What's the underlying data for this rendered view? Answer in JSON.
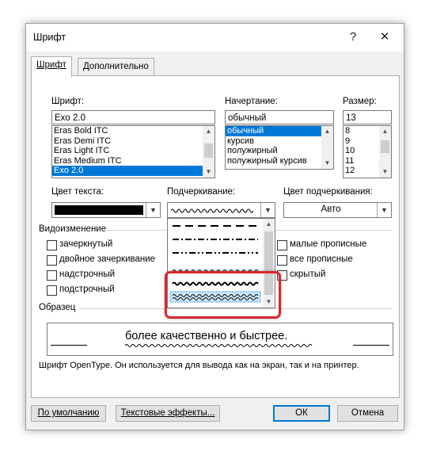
{
  "dialog": {
    "title": "Шрифт",
    "help": "?",
    "close": "✕"
  },
  "tabs": [
    {
      "label": "Шрифт"
    },
    {
      "label": "Дополнительно"
    }
  ],
  "font": {
    "label": "Шрифт:",
    "value": "Exo 2.0",
    "items": [
      "Eras Bold ITC",
      "Eras Demi ITC",
      "Eras Light ITC",
      "Eras Medium ITC",
      "Exo 2.0"
    ],
    "selected_index": 4
  },
  "style": {
    "label": "Начертание:",
    "value": "обычный",
    "items": [
      "обычный",
      "курсив",
      "полужирный",
      "полужирный курсив"
    ],
    "selected_index": 0
  },
  "size": {
    "label": "Размер:",
    "value": "13",
    "items": [
      "8",
      "9",
      "10",
      "11",
      "12"
    ]
  },
  "text_color": {
    "label": "Цвет текста:",
    "color": "#000000"
  },
  "underline": {
    "label": "Подчеркивание:",
    "options": [
      "long-dash",
      "dash-dot",
      "dash-dot-dot",
      "wave",
      "heavy-wave",
      "double-wave"
    ],
    "highlighted_index": 5
  },
  "underline_color": {
    "label": "Цвет подчеркивания:",
    "value": "Авто"
  },
  "effects": {
    "label": "Видоизменение",
    "left": [
      "зачеркнутый",
      "двойное зачеркивание",
      "надстрочный",
      "подстрочный"
    ],
    "right": [
      "малые прописные",
      "все прописные",
      "скрытый"
    ]
  },
  "preview": {
    "label": "Образец",
    "text": "более качественно и быстрее.",
    "note": "Шрифт OpenType. Он используется для вывода как на экран, так и на принтер."
  },
  "buttons": {
    "default": "По умолчанию",
    "effects": "Текстовые эффекты...",
    "ok": "ОК",
    "cancel": "Отмена"
  },
  "colors": {
    "accent": "#0078d7",
    "highlight_box": "#d9272e"
  }
}
